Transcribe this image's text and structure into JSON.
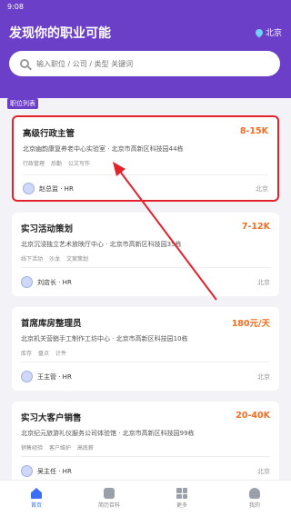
{
  "statusbar": {
    "time": "9:08"
  },
  "header": {
    "title": "发现你的职业可能",
    "location": "北京",
    "search_placeholder": "输入职位 / 公司 / 类型 关键词"
  },
  "section_label": "职位列表",
  "jobs": [
    {
      "title": "高级行政主管",
      "salary": "8-15K",
      "company": "北京幽韵康复养老中心实验室 · 北京市高新区科技园44栋",
      "tags": [
        "行政管理",
        "后勤",
        "公文写作"
      ],
      "recruiter": "赵总监 · HR",
      "city": "北京"
    },
    {
      "title": "实习活动策划",
      "salary": "7-12K",
      "company": "北京沉浸独立艺术放映厅中心 · 北京市高新区科技园35栋",
      "tags": [
        "线下活动",
        "沙龙",
        "文案策划"
      ],
      "recruiter": "刘店长 · HR",
      "city": "北京"
    },
    {
      "title": "首席库房整理员",
      "salary": "180元/天",
      "company": "北京机关营銷手工制作工坊中心 · 北京市高新区科技园10栋",
      "tags": [
        "库存",
        "盘点",
        "计件"
      ],
      "recruiter": "王主管 · HR",
      "city": "北京"
    },
    {
      "title": "实习大客户销售",
      "salary": "20-40K",
      "company": "北京纪元旅游礼仪服务公司体验馆 · 北京市高新区科技园99栋",
      "tags": [
        "销售经验",
        "客户维护",
        "高底薪"
      ],
      "recruiter": "吴主任 · HR",
      "city": "北京"
    }
  ],
  "tabs": [
    {
      "label": "首页",
      "active": true
    },
    {
      "label": "简历百科",
      "active": false
    },
    {
      "label": "更多",
      "active": false
    },
    {
      "label": "我的",
      "active": false
    }
  ],
  "colors": {
    "brand": "#6c3fc8",
    "salary": "#f26d21",
    "annotation": "#e3222b",
    "tab_active": "#3a6ef5"
  }
}
